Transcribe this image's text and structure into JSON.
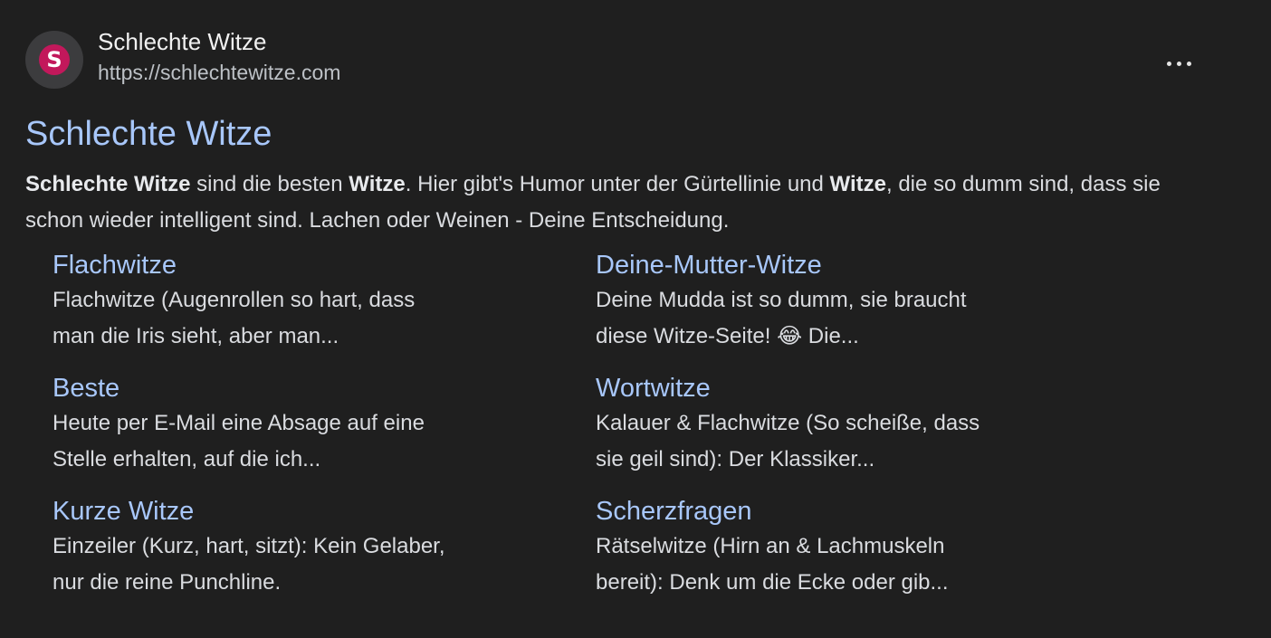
{
  "site": {
    "favicon_letter": "S",
    "name": "Schlechte Witze",
    "url": "https://schlechtewitze.com",
    "more_icon": "more-horiz-icon"
  },
  "result": {
    "title": "Schlechte Witze",
    "snippet": [
      {
        "text": "Schlechte Witze",
        "bold": true
      },
      {
        "text": " sind die besten ",
        "bold": false
      },
      {
        "text": "Witze",
        "bold": true
      },
      {
        "text": ". Hier gibt's Humor unter der Gürtellinie und ",
        "bold": false
      },
      {
        "text": "Witze",
        "bold": true
      },
      {
        "text": ", die so dumm sind, dass sie schon wieder intelligent sind. Lachen oder Weinen - Deine Entscheidung.",
        "bold": false
      }
    ]
  },
  "sitelinks": [
    {
      "title": "Flachwitze",
      "desc": [
        "Flachwitze (Augenrollen so hart, dass",
        "man die Iris sieht, aber man..."
      ]
    },
    {
      "title": "Deine-Mutter-Witze",
      "desc": [
        "Deine Mudda ist so dumm, sie braucht",
        "diese Witze-Seite! 😂 Die..."
      ]
    },
    {
      "title": "Beste",
      "desc": [
        "Heute per E-Mail eine Absage auf eine",
        "Stelle erhalten, auf die ich..."
      ]
    },
    {
      "title": "Wortwitze",
      "desc": [
        "Kalauer & Flachwitze (So scheiße, dass",
        "sie geil sind): Der Klassiker..."
      ]
    },
    {
      "title": "Kurze Witze",
      "desc": [
        "Einzeiler (Kurz, hart, sitzt): Kein Gelaber,",
        "nur die reine Punchline."
      ]
    },
    {
      "title": "Scherzfragen",
      "desc": [
        "Rätselwitze (Hirn an & Lachmuskeln",
        "bereit): Denk um die Ecke oder gib..."
      ]
    }
  ],
  "colors": {
    "background": "#1f1f1f",
    "link": "#a8c7fa",
    "text": "#dadce0",
    "favicon": "#c2185b"
  }
}
